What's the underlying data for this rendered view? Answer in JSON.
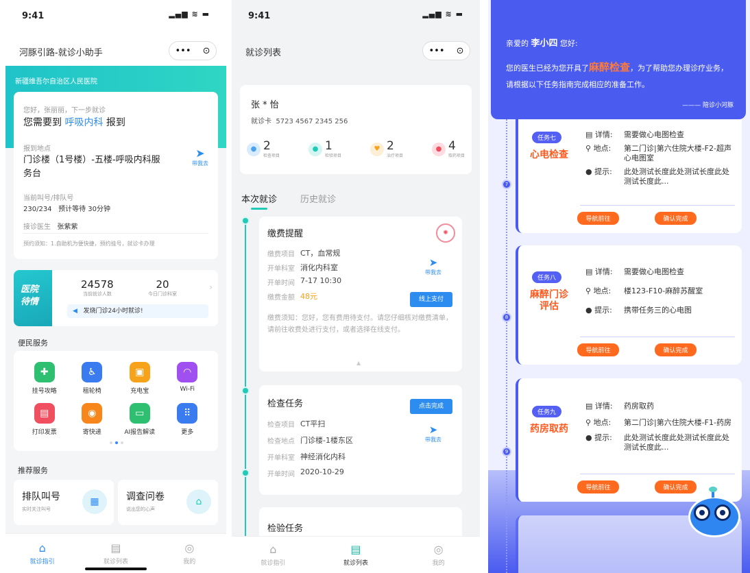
{
  "p1": {
    "time": "9:41",
    "signal": "▂▄▆ ≋ ▬",
    "title": "河豚引路-就诊小助手",
    "caps_more": "•••",
    "caps_close": "⊙",
    "hospital": "新疆维吾尔自治区人民医院",
    "greet_small": "您好，张丽丽，下一步就诊",
    "need_prefix": "您需要到",
    "dept": "呼吸内科",
    "need_suffix": "报到",
    "loc_label": "报到地点",
    "location": "门诊楼（1号楼）-五楼-呼吸内科服务台",
    "nav_label": "带我去",
    "queue_label": "当前叫号/排队号",
    "queue_value": "230/234",
    "wait": "预计等待 30分钟",
    "doctor_label": "接诊医生",
    "doctor": "张紫紫",
    "notice": "预约须知：1.自助机为便快捷，预约挂号，就诊卡办理",
    "banner_title_1": "医院",
    "banner_title_2": "待情",
    "stat1_num": "24578",
    "stat1_lbl": "当前就诊人数",
    "stat2_num": "20",
    "stat2_lbl": "今日门诊科室",
    "fever": "发烧门诊24小时就诊!",
    "service_title": "便民服务",
    "services": [
      {
        "label": "挂号攻略",
        "color": "#2fbf71",
        "icon": "✚"
      },
      {
        "label": "租轮椅",
        "color": "#3a7bf0",
        "icon": "♿"
      },
      {
        "label": "充电宝",
        "color": "#f7a21b",
        "icon": "▣"
      },
      {
        "label": "Wi-Fi",
        "color": "#a04ff0",
        "icon": "◠"
      },
      {
        "label": "打印发票",
        "color": "#f04f5f",
        "icon": "▤"
      },
      {
        "label": "寄快递",
        "color": "#f7861b",
        "icon": "◉"
      },
      {
        "label": "AI报告解读",
        "color": "#2fbf71",
        "icon": "▭"
      },
      {
        "label": "更多",
        "color": "#3a7bf0",
        "icon": "⠿"
      }
    ],
    "recommend_title": "推荐服务",
    "rec1_title": "排队叫号",
    "rec1_sub": "实时关注叫号",
    "rec2_title": "调查问卷",
    "rec2_sub": "说出您的心声",
    "tabs": [
      {
        "label": "就诊指引",
        "icon": "⌂"
      },
      {
        "label": "就诊列表",
        "icon": "▤"
      },
      {
        "label": "我的",
        "icon": "◎"
      }
    ]
  },
  "p2": {
    "time": "9:41",
    "signal": "▂▄▆ ≋ ▬",
    "title": "就诊列表",
    "caps_more": "•••",
    "caps_close": "⊙",
    "patient": "张 * 怡",
    "card_label": "就诊卡",
    "card_no": "5723 4567 2345 256",
    "stats": [
      {
        "num": "2",
        "lbl": "检查项目",
        "color": "#4aa3f0"
      },
      {
        "num": "1",
        "lbl": "检验项目",
        "color": "#20c9b8"
      },
      {
        "num": "2",
        "lbl": "治疗项目",
        "color": "#f7a21b"
      },
      {
        "num": "4",
        "lbl": "取药项目",
        "color": "#f04f5f"
      }
    ],
    "tab_current": "本次就诊",
    "tab_history": "历史就诊",
    "pay_title": "缴费提醒",
    "pay_rows": [
      {
        "k": "缴费项目",
        "v": "CT，血常规"
      },
      {
        "k": "开单科室",
        "v": "消化内科室"
      },
      {
        "k": "开单时间",
        "v": "7-17 10:30"
      },
      {
        "k": "缴费金额",
        "v": "48元"
      }
    ],
    "nav_label": "带我去",
    "pay_btn": "线上支付",
    "pay_notice": "缴费须知：您好，您有费用待支付。请您仔细核对缴费清单，请前往收费处进行支付，或者选择在线支付。",
    "exam_title": "检查任务",
    "exam_btn": "点击完成",
    "exam_rows": [
      {
        "k": "检查项目",
        "v": "CT平扫"
      },
      {
        "k": "检查地点",
        "v": "门诊楼-1楼东区"
      },
      {
        "k": "开单科室",
        "v": "神经消化内科"
      },
      {
        "k": "开单时间",
        "v": "2020-10-29"
      }
    ],
    "lab_title": "检验任务",
    "tabs": [
      {
        "label": "就诊指引",
        "icon": "⌂"
      },
      {
        "label": "就诊列表",
        "icon": "▤"
      },
      {
        "label": "我的",
        "icon": "◎"
      }
    ]
  },
  "p3": {
    "greet_prefix": "亲爱的",
    "name": "李小四",
    "greet_suffix": "您好:",
    "msg_prefix": "您的医生已经为您开具了",
    "highlight": "麻醉检查",
    "msg_suffix": "，为了帮助您办理诊疗业务，请根据以下任务指南完成相应的准备工作。",
    "sign": "——— 陪诊小河豚",
    "tasks": [
      {
        "num": "7",
        "tag": "任务七",
        "name": "心电检查",
        "detail_label": "详情:",
        "detail": "需要做心电图检查",
        "loc_label": "地点:",
        "loc": "第二门诊|第六住院大楼-F2-超声心电图室",
        "tip_label": "提示:",
        "tip": "此处测试长度此处测试长度此处测试长度此..."
      },
      {
        "num": "8",
        "tag": "任务八",
        "name": "麻醉门诊评估",
        "detail_label": "详情:",
        "detail": "需要做心电图检查",
        "loc_label": "地点:",
        "loc": "楼123-F10-麻醉苏醒室",
        "tip_label": "提示:",
        "tip": "携带任务三的心电图"
      },
      {
        "num": "9",
        "tag": "任务九",
        "name": "药房取药",
        "detail_label": "详情:",
        "detail": "药房取药",
        "loc_label": "地点:",
        "loc": "第二门诊|第六住院大楼-F1-药房",
        "tip_label": "提示:",
        "tip": "此处测试长度此处测试长度此处测试长度此..."
      }
    ],
    "btn_nav": "导航前往",
    "btn_done": "确认完成"
  }
}
